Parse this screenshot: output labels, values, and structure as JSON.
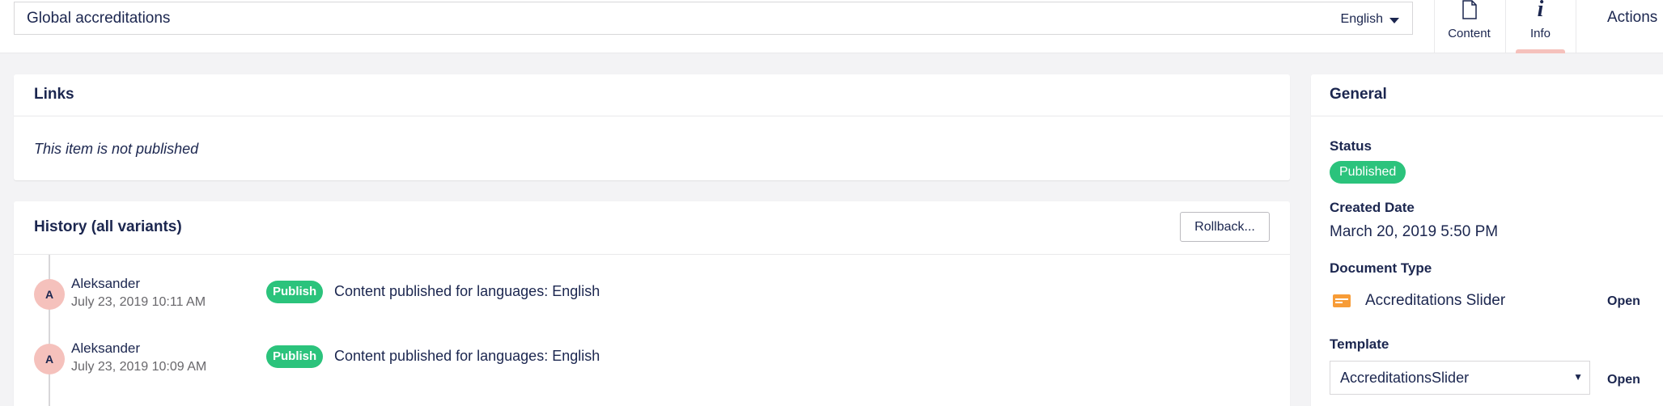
{
  "header": {
    "document_name": "Global accreditations",
    "language": "English",
    "tabs": [
      {
        "label": "Content",
        "icon": "document-icon"
      },
      {
        "label": "Info",
        "icon": "info-icon"
      }
    ],
    "actions_label": "Actions"
  },
  "links": {
    "title": "Links",
    "not_published": "This item is not published"
  },
  "history": {
    "title": "History (all variants)",
    "rollback_label": "Rollback...",
    "entries": [
      {
        "initial": "A",
        "user": "Aleksander",
        "date": "July 23, 2019 10:11 AM",
        "badge": "Publish",
        "message": "Content published for languages: English"
      },
      {
        "initial": "A",
        "user": "Aleksander",
        "date": "July 23, 2019 10:09 AM",
        "badge": "Publish",
        "message": "Content published for languages: English"
      }
    ]
  },
  "general": {
    "title": "General",
    "status_label": "Status",
    "status_value": "Published",
    "created_label": "Created Date",
    "created_value": "March 20, 2019 5:50 PM",
    "doctype_label": "Document Type",
    "doctype_value": "Accreditations Slider",
    "template_label": "Template",
    "template_value": "AccreditationsSlider",
    "open_label": "Open"
  },
  "colors": {
    "brand_navy": "#1b264f",
    "publish_green": "#2bc37c",
    "avatar_pink": "#f5c1bc",
    "doctype_orange": "#f79c37"
  }
}
